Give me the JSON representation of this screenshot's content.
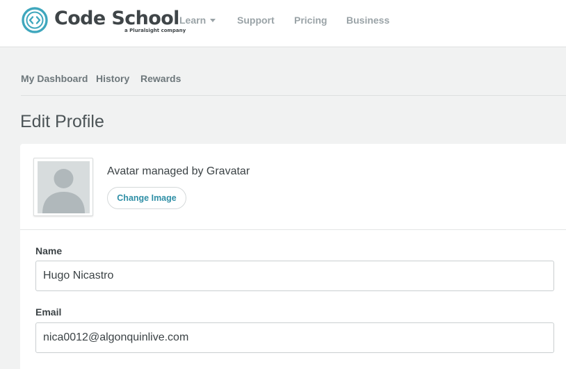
{
  "header": {
    "logo": {
      "name": "Code School",
      "tagline": "a Pluralsight company",
      "icon": "code-brackets-icon",
      "accent_color": "#3fa7bd"
    },
    "nav": [
      {
        "label": "Learn",
        "has_dropdown": true
      },
      {
        "label": "Support"
      },
      {
        "label": "Pricing"
      },
      {
        "label": "Business"
      }
    ]
  },
  "subnav": {
    "items": [
      {
        "label": "My Dashboard"
      },
      {
        "label": "History"
      },
      {
        "label": "Rewards"
      }
    ]
  },
  "page": {
    "title": "Edit Profile"
  },
  "profile": {
    "avatar": {
      "icon": "default-user-silhouette-icon",
      "caption": "Avatar managed by Gravatar",
      "change_button_label": "Change Image"
    },
    "fields": {
      "name": {
        "label": "Name",
        "value": "Hugo Nicastro"
      },
      "email": {
        "label": "Email",
        "value": "nica0012@algonquinlive.com"
      }
    }
  },
  "colors": {
    "link_accent": "#2f8fa6",
    "page_background": "#f1f2f2",
    "nav_text": "#9aa3a7"
  }
}
